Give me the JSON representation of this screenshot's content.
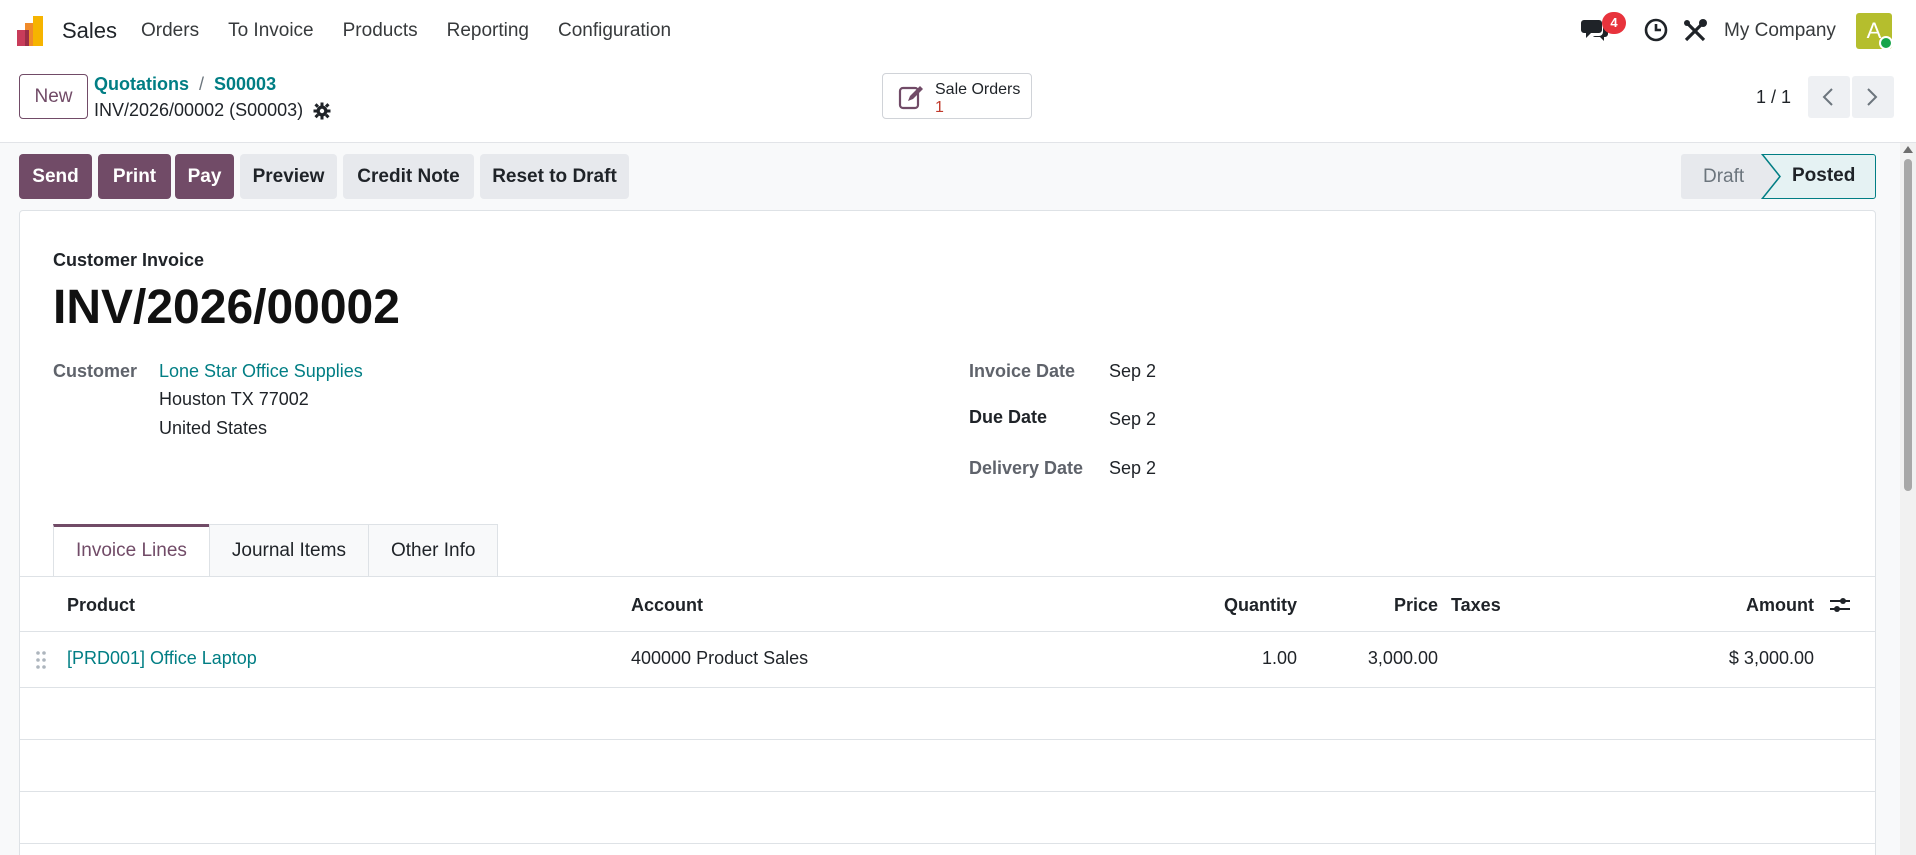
{
  "navbar": {
    "app_name": "Sales",
    "menu": [
      "Orders",
      "To Invoice",
      "Products",
      "Reporting",
      "Configuration"
    ],
    "chat_count": "4",
    "company": "My Company",
    "avatar_letter": "A"
  },
  "control": {
    "new_label": "New",
    "breadcrumb": [
      "Quotations",
      "S00003"
    ],
    "record_title": "INV/2026/00002 (S00003)",
    "smart_button": {
      "label": "Sale Orders",
      "count": "1"
    },
    "pager": "1 / 1"
  },
  "actions": {
    "send": "Send",
    "print": "Print",
    "pay": "Pay",
    "preview": "Preview",
    "credit_note": "Credit Note",
    "reset": "Reset to Draft"
  },
  "status": {
    "draft": "Draft",
    "posted": "Posted",
    "current": "Posted"
  },
  "invoice": {
    "type": "Customer Invoice",
    "name": "INV/2026/00002",
    "customer_label": "Customer",
    "customer_name": "Lone Star Office Supplies",
    "customer_address1": "Houston TX 77002",
    "customer_address2": "United States",
    "invoice_date_label": "Invoice Date",
    "invoice_date": "Sep 2",
    "due_date_label": "Due Date",
    "due_date": "Sep 2",
    "delivery_date_label": "Delivery Date",
    "delivery_date": "Sep 2"
  },
  "tabs": [
    "Invoice Lines",
    "Journal Items",
    "Other Info"
  ],
  "lines": {
    "headers": {
      "product": "Product",
      "account": "Account",
      "quantity": "Quantity",
      "price": "Price",
      "taxes": "Taxes",
      "amount": "Amount"
    },
    "rows": [
      {
        "product": "[PRD001] Office Laptop",
        "account": "400000 Product Sales",
        "quantity": "1.00",
        "price": "3,000.00",
        "taxes": "",
        "amount": "$ 3,000.00"
      }
    ]
  },
  "colors": {
    "brand": "#714b67",
    "link": "#017e84",
    "badge": "#e8333c"
  }
}
